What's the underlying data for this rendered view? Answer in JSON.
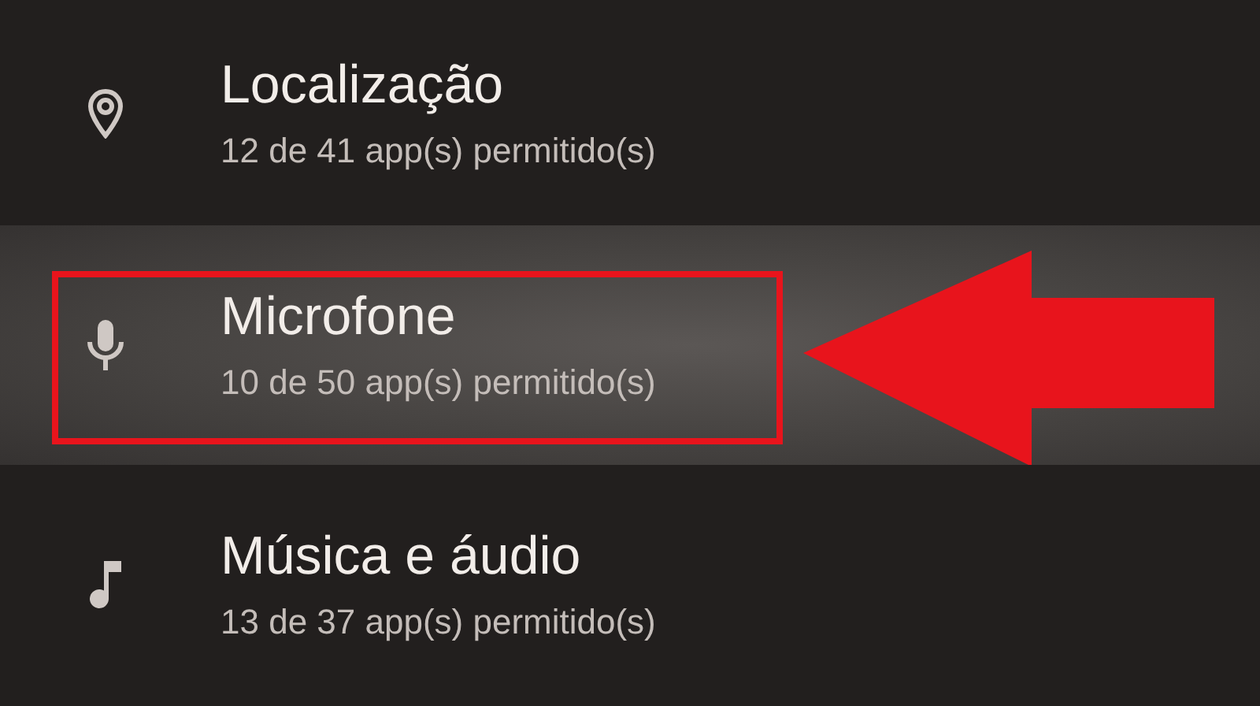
{
  "items": [
    {
      "title": "Localização",
      "subtitle": "12 de 41 app(s) permitido(s)",
      "selected": false
    },
    {
      "title": "Microfone",
      "subtitle": "10 de 50 app(s) permitido(s)",
      "selected": true
    },
    {
      "title": "Música e áudio",
      "subtitle": "13 de 37 app(s) permitido(s)",
      "selected": false
    }
  ]
}
